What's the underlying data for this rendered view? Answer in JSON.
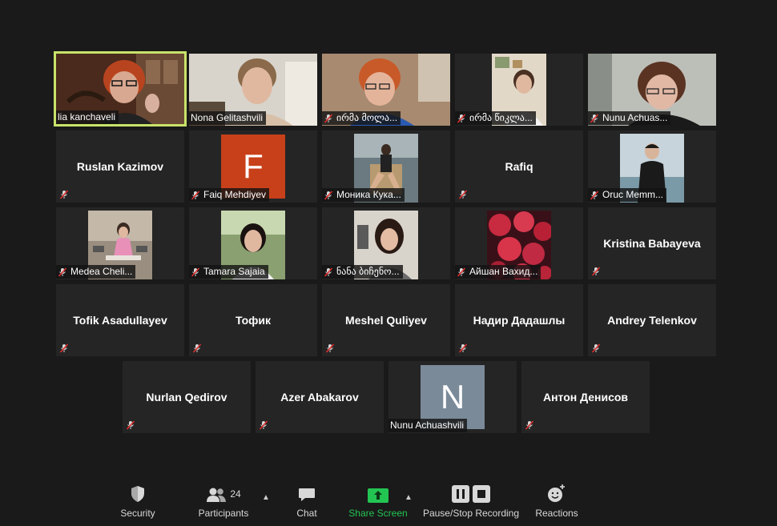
{
  "participants_row1": [
    {
      "name": "lia kanchaveli"
    },
    {
      "name": "Nona Gelitashvili"
    },
    {
      "name": "ირმა მოლა..."
    },
    {
      "name": "ირმა წიკლა..."
    },
    {
      "name": "Nunu Achuas..."
    }
  ],
  "participants_row2": [
    {
      "name": "Ruslan Kazimov"
    },
    {
      "name": "Faiq Mehdiyev",
      "avatar_letter": "F"
    },
    {
      "name": "Моника Кука..."
    },
    {
      "name": "Rafiq"
    },
    {
      "name": "Oruc Memm..."
    }
  ],
  "participants_row3": [
    {
      "name": "Medea Cheli..."
    },
    {
      "name": "Tamara Sajaia"
    },
    {
      "name": "ნანა ბიჩენო..."
    },
    {
      "name": "Айшан Вахид..."
    },
    {
      "name": "Kristina Babayeva"
    }
  ],
  "participants_row4": [
    {
      "name": "Tofik Asadullayev"
    },
    {
      "name": "Тофик"
    },
    {
      "name": "Meshel Quliyev"
    },
    {
      "name": "Надир Дадашлы"
    },
    {
      "name": "Andrey Telenkov"
    }
  ],
  "participants_row5": [
    {
      "name": "Nurlan Qedirov"
    },
    {
      "name": "Azer Abakarov"
    },
    {
      "name": "Nunu Achuashvili",
      "avatar_letter": "N"
    },
    {
      "name": "Антон Денисов"
    }
  ],
  "toolbar": {
    "security": "Security",
    "participants": "Participants",
    "participants_count": "24",
    "chat": "Chat",
    "share_screen": "Share Screen",
    "recording": "Pause/Stop Recording",
    "reactions": "Reactions"
  },
  "colors": {
    "background": "#1a1a1a",
    "tile": "#252525",
    "active_speaker_border": "#c8e36a",
    "share_screen_green": "#23c552",
    "mute_red": "#e02f2f",
    "avatar_f": "#c8401a",
    "avatar_n": "#7a8a99"
  }
}
